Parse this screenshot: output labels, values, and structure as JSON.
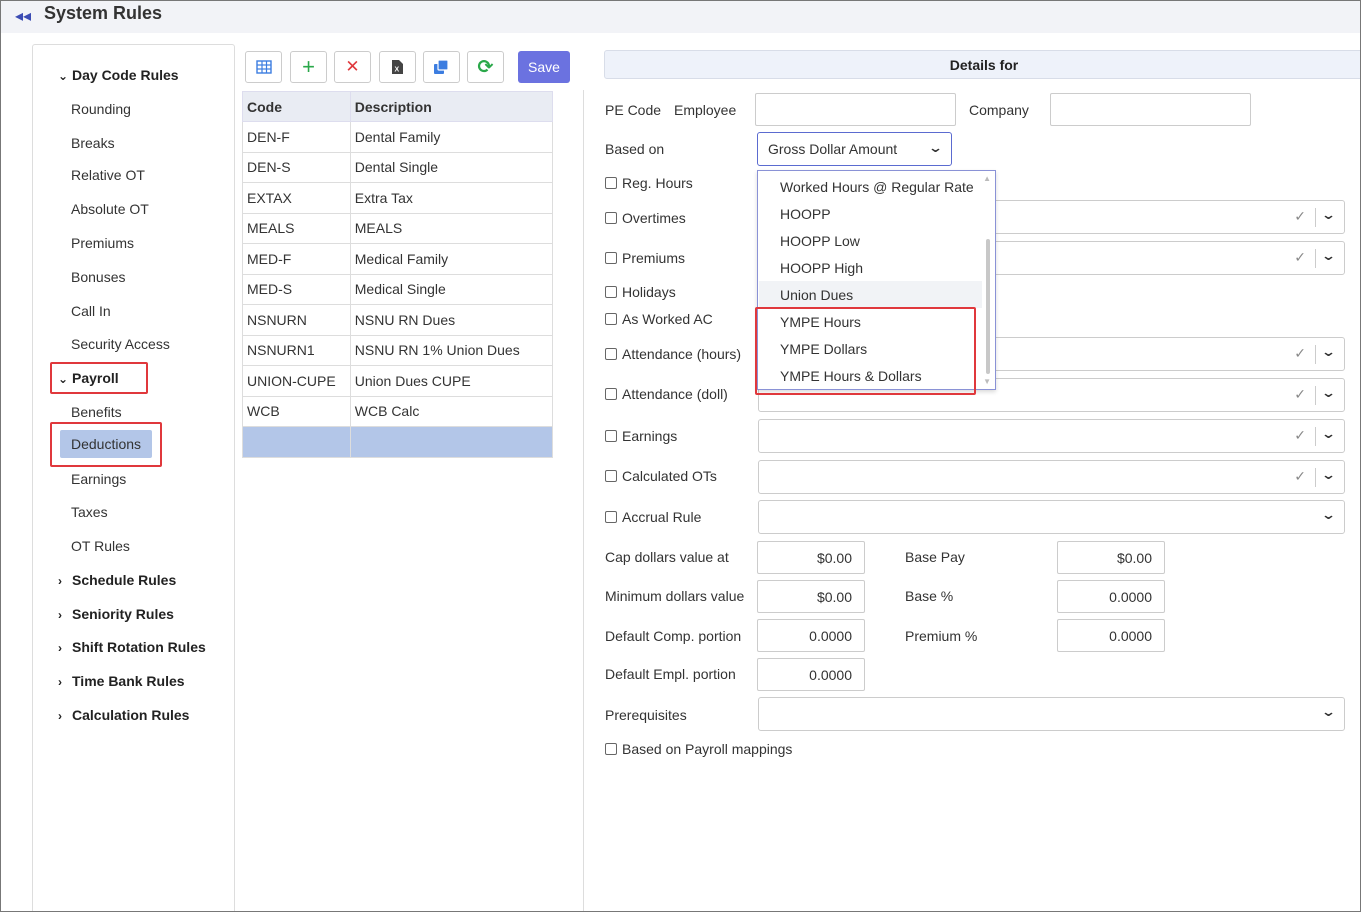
{
  "header": {
    "title": "System Rules"
  },
  "sidebar": {
    "groups": [
      {
        "label": "Day Code Rules",
        "expanded": true,
        "items": [
          "Rounding",
          "Breaks",
          "Relative OT",
          "Absolute OT",
          "Premiums",
          "Bonuses",
          "Call In",
          "Security Access"
        ]
      },
      {
        "label": "Payroll",
        "expanded": true,
        "items": [
          "Benefits",
          "Deductions",
          "Earnings",
          "Taxes",
          "OT Rules"
        ],
        "selected": "Deductions"
      },
      {
        "label": "Schedule Rules",
        "expanded": false
      },
      {
        "label": "Seniority Rules",
        "expanded": false
      },
      {
        "label": "Shift Rotation Rules",
        "expanded": false
      },
      {
        "label": "Time Bank Rules",
        "expanded": false
      },
      {
        "label": "Calculation Rules",
        "expanded": false
      }
    ]
  },
  "toolbar": {
    "buttons": [
      "grid-icon",
      "add-icon",
      "delete-icon",
      "export-excel-icon",
      "copy-icon",
      "refresh-icon"
    ],
    "save_label": "Save",
    "colors": {
      "add": "#2aa84a",
      "delete": "#e0383c",
      "copy": "#3c7de0",
      "refresh": "#2aa84a",
      "save": "#6b72e0"
    }
  },
  "codes_table": {
    "headers": [
      "Code",
      "Description"
    ],
    "rows": [
      [
        "DEN-F",
        "Dental Family"
      ],
      [
        "DEN-S",
        "Dental Single"
      ],
      [
        "EXTAX",
        "Extra Tax"
      ],
      [
        "MEALS",
        "MEALS"
      ],
      [
        "MED-F",
        "Medical Family"
      ],
      [
        "MED-S",
        "Medical Single"
      ],
      [
        "NSNURN",
        "NSNU RN Dues"
      ],
      [
        "NSNURN1",
        "NSNU RN 1% Union Dues"
      ],
      [
        "UNION-CUPE",
        "Union Dues CUPE"
      ],
      [
        "WCB",
        "WCB Calc"
      ],
      [
        "",
        ""
      ]
    ]
  },
  "details": {
    "header": "Details for",
    "pe_code_label": "PE Code",
    "employee_label": "Employee",
    "company_label": "Company",
    "based_on_label": "Based on",
    "based_on_value": "Gross Dollar Amount",
    "dropdown_options": [
      "Worked Hours @ Regular Rate",
      "HOOPP",
      "HOOPP Low",
      "HOOPP High",
      "Union Dues",
      "YMPE Hours",
      "YMPE Dollars",
      "YMPE Hours & Dollars"
    ],
    "checkboxes": {
      "reg_hours": "Reg. Hours",
      "overtimes": "Overtimes",
      "premiums": "Premiums",
      "holidays": "Holidays",
      "as_worked_ac": "As Worked AC",
      "attendance_hours": "Attendance (hours)",
      "attendance_doll": "Attendance (doll)",
      "earnings": "Earnings",
      "calculated_ots": "Calculated OTs",
      "accrual_rule": "Accrual Rule",
      "based_on_payroll": "Based on Payroll mappings"
    },
    "cap_label": "Cap dollars value at",
    "cap_value": "$0.00",
    "min_label": "Minimum dollars value",
    "min_value": "$0.00",
    "comp_label": "Default Comp. portion",
    "comp_value": "0.0000",
    "empl_label": "Default Empl. portion",
    "empl_value": "0.0000",
    "base_pay_label": "Base Pay",
    "base_pay_value": "$0.00",
    "base_pct_label": "Base %",
    "base_pct_value": "0.0000",
    "premium_pct_label": "Premium %",
    "premium_pct_value": "0.0000",
    "prereq_label": "Prerequisites"
  }
}
